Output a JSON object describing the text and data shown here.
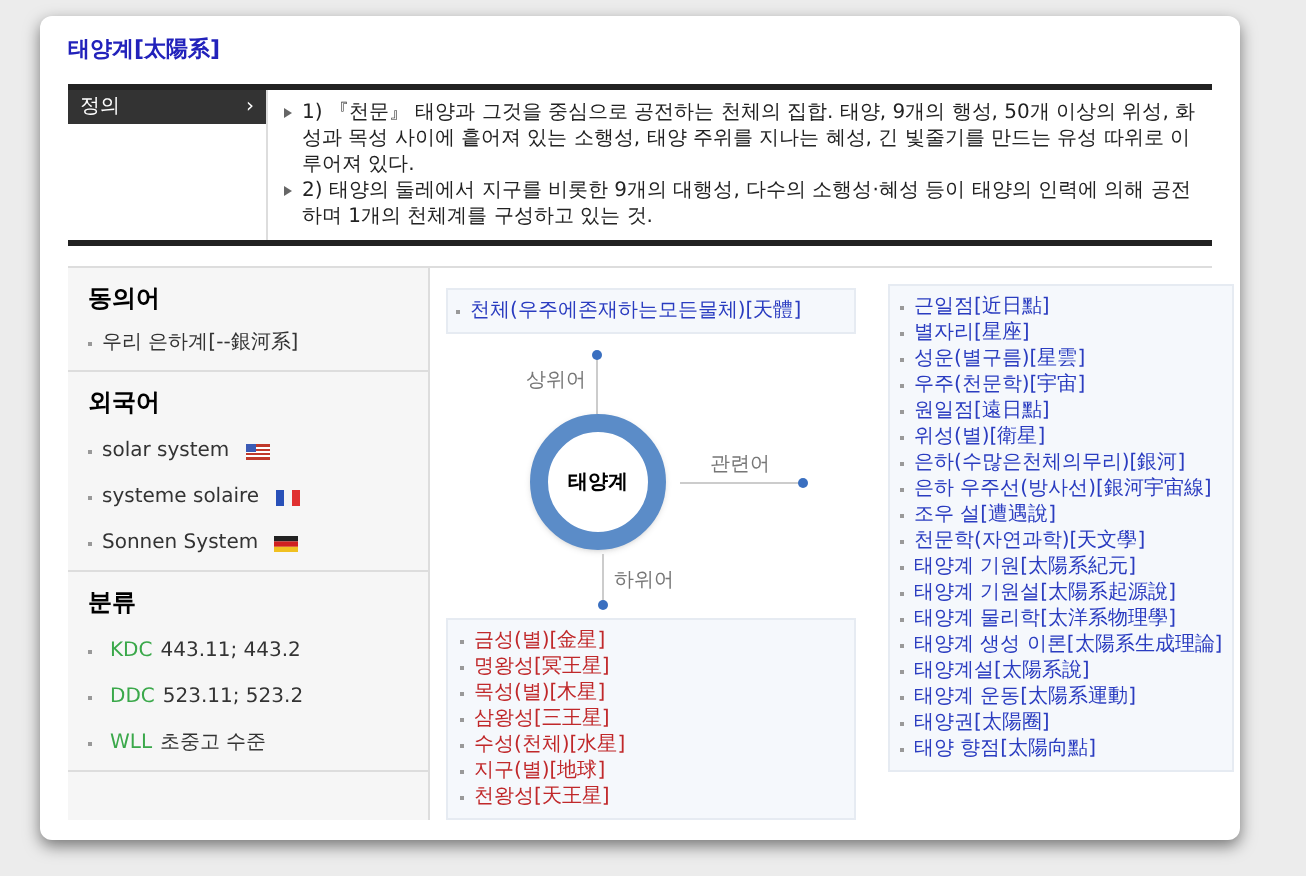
{
  "title": "태양계[太陽系]",
  "definition": {
    "label": "정의",
    "arrow": "›",
    "items": [
      "1) 『천문』 태양과 그것을 중심으로 공전하는 천체의 집합. 태양, 9개의 행성, 50개 이상의 위성, 화성과 목성 사이에 흩어져 있는 소행성, 태양 주위를 지나는 혜성, 긴 빛줄기를 만드는 유성 따위로 이루어져 있다.",
      "2) 태양의 둘레에서 지구를 비롯한 9개의 대행성, 다수의 소행성·혜성 등이 태양의 인력에 의해 공전하며 1개의 천체계를 구성하고 있는 것."
    ]
  },
  "synonyms": {
    "heading": "동의어",
    "items": [
      "우리 은하계[--銀河系]"
    ]
  },
  "foreign": {
    "heading": "외국어",
    "items": [
      {
        "text": "solar system",
        "kind": "us"
      },
      {
        "text": "systeme solaire",
        "kind": "fr"
      },
      {
        "text": "Sonnen System",
        "kind": "de"
      }
    ]
  },
  "classification": {
    "heading": "분류",
    "items": [
      {
        "code": "KDC",
        "value": "443.11; 443.2"
      },
      {
        "code": "DDC",
        "value": "523.11; 523.2"
      },
      {
        "code": "WLL",
        "value": "초중고 수준"
      }
    ]
  },
  "diagram": {
    "center": "태양계",
    "upper_label": "상위어",
    "related_label": "관련어",
    "lower_label": "하위어"
  },
  "upper_terms": [
    "천체(우주에존재하는모든물체)[天體]"
  ],
  "lower_terms": [
    "금성(별)[金星]",
    "명왕성[冥王星]",
    "목성(별)[木星]",
    "삼왕성[三王星]",
    "수성(천체)[水星]",
    "지구(별)[地球]",
    "천왕성[天王星]"
  ],
  "related_terms": [
    "근일점[近日點]",
    "별자리[星座]",
    "성운(별구름)[星雲]",
    "우주(천문학)[宇宙]",
    "원일점[遠日點]",
    "위성(별)[衛星]",
    "은하(수많은천체의무리)[銀河]",
    "은하 우주선(방사선)[銀河宇宙線]",
    "조우 설[遭遇說]",
    "천문학(자연과학)[天文學]",
    "태양계 기원[太陽系紀元]",
    "태양계 기원설[太陽系起源說]",
    "태양계 물리학[太洋系物理學]",
    "태양계 생성 이론[太陽系生成理論]",
    "태양계설[太陽系說]",
    "태양계 운동[太陽系運動]",
    "태양권[太陽圈]",
    "태양 향점[太陽向點]"
  ]
}
